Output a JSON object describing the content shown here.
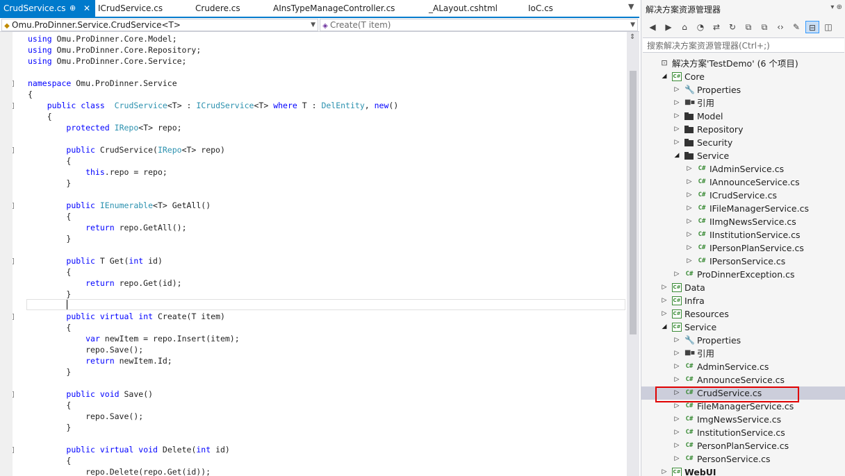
{
  "editor": {
    "tabs": [
      {
        "label": "CrudService.cs",
        "active": true
      },
      {
        "label": "ICrudService.cs"
      },
      {
        "label": "Crudere.cs"
      },
      {
        "label": "AInsTypeManageController.cs"
      },
      {
        "label": "_ALayout.cshtml"
      },
      {
        "label": "IoC.cs"
      }
    ],
    "tab_pin": "⊕",
    "tab_close": "✕",
    "overflow_glyph": "▼",
    "nav_left": "Omu.ProDinner.Service.CrudService<T>",
    "nav_right": "Create(T item)",
    "code_lines": [
      {
        "text": "using Omu.ProDinner.Core.Model;",
        "fold": ""
      },
      {
        "text": "using Omu.ProDinner.Core.Repository;",
        "fold": ""
      },
      {
        "text": "using Omu.ProDinner.Core.Service;",
        "fold": ""
      },
      {
        "text": "",
        "fold": ""
      },
      {
        "text": "namespace Omu.ProDinner.Service",
        "fold": "−"
      },
      {
        "text": "{",
        "fold": ""
      },
      {
        "text": "    public class  CrudService<T> : ICrudService<T> where T : DelEntity, new()",
        "fold": "−"
      },
      {
        "text": "    {",
        "fold": ""
      },
      {
        "text": "        protected IRepo<T> repo;",
        "fold": ""
      },
      {
        "text": "",
        "fold": ""
      },
      {
        "text": "        public CrudService(IRepo<T> repo)",
        "fold": "−"
      },
      {
        "text": "        {",
        "fold": ""
      },
      {
        "text": "            this.repo = repo;",
        "fold": ""
      },
      {
        "text": "        }",
        "fold": ""
      },
      {
        "text": "",
        "fold": ""
      },
      {
        "text": "        public IEnumerable<T> GetAll()",
        "fold": "−"
      },
      {
        "text": "        {",
        "fold": ""
      },
      {
        "text": "            return repo.GetAll();",
        "fold": ""
      },
      {
        "text": "        }",
        "fold": ""
      },
      {
        "text": "",
        "fold": ""
      },
      {
        "text": "        public T Get(int id)",
        "fold": "−"
      },
      {
        "text": "        {",
        "fold": ""
      },
      {
        "text": "            return repo.Get(id);",
        "fold": ""
      },
      {
        "text": "        }",
        "fold": ""
      },
      {
        "text": "",
        "fold": ""
      },
      {
        "text": "        public virtual int Create(T item)",
        "fold": "−"
      },
      {
        "text": "        {",
        "fold": ""
      },
      {
        "text": "            var newItem = repo.Insert(item);",
        "fold": ""
      },
      {
        "text": "            repo.Save();",
        "fold": ""
      },
      {
        "text": "            return newItem.Id;",
        "fold": ""
      },
      {
        "text": "        }",
        "fold": ""
      },
      {
        "text": "",
        "fold": ""
      },
      {
        "text": "        public void Save()",
        "fold": "−"
      },
      {
        "text": "        {",
        "fold": ""
      },
      {
        "text": "            repo.Save();",
        "fold": ""
      },
      {
        "text": "        }",
        "fold": ""
      },
      {
        "text": "",
        "fold": ""
      },
      {
        "text": "        public virtual void Delete(int id)",
        "fold": "−"
      },
      {
        "text": "        {",
        "fold": ""
      },
      {
        "text": "            repo.Delete(repo.Get(id));",
        "fold": ""
      }
    ]
  },
  "explorer": {
    "title": "解决方案资源管理器",
    "title_buttons": "▾ ⊕",
    "toolbar": [
      "◀",
      "▶",
      "⌂",
      "◔",
      "⇄",
      "↻",
      "⧉",
      "⧉",
      "‹›",
      "✎",
      "⊟",
      "◫"
    ],
    "search_placeholder": "搜索解决方案资源管理器(Ctrl+;)",
    "tree": [
      {
        "label": "解决方案'TestDemo' (6 个项目)",
        "depth": 0,
        "icon": "sln",
        "arrow": ""
      },
      {
        "label": "Core",
        "depth": 1,
        "icon": "proj",
        "arrow": "open"
      },
      {
        "label": "Properties",
        "depth": 2,
        "icon": "wrench",
        "arrow": "closed"
      },
      {
        "label": "引用",
        "depth": 2,
        "icon": "refs",
        "arrow": "closed"
      },
      {
        "label": "Model",
        "depth": 2,
        "icon": "folder",
        "arrow": "closed"
      },
      {
        "label": "Repository",
        "depth": 2,
        "icon": "folder",
        "arrow": "closed"
      },
      {
        "label": "Security",
        "depth": 2,
        "icon": "folder",
        "arrow": "closed"
      },
      {
        "label": "Service",
        "depth": 2,
        "icon": "folder",
        "arrow": "open"
      },
      {
        "label": "IAdminService.cs",
        "depth": 3,
        "icon": "cs",
        "arrow": "closed"
      },
      {
        "label": "IAnnounceService.cs",
        "depth": 3,
        "icon": "cs",
        "arrow": "closed"
      },
      {
        "label": "ICrudService.cs",
        "depth": 3,
        "icon": "cs",
        "arrow": "closed"
      },
      {
        "label": "IFileManagerService.cs",
        "depth": 3,
        "icon": "cs",
        "arrow": "closed"
      },
      {
        "label": "IImgNewsService.cs",
        "depth": 3,
        "icon": "cs",
        "arrow": "closed"
      },
      {
        "label": "IInstitutionService.cs",
        "depth": 3,
        "icon": "cs",
        "arrow": "closed"
      },
      {
        "label": "IPersonPlanService.cs",
        "depth": 3,
        "icon": "cs",
        "arrow": "closed"
      },
      {
        "label": "IPersonService.cs",
        "depth": 3,
        "icon": "cs",
        "arrow": "closed"
      },
      {
        "label": "ProDinnerException.cs",
        "depth": 2,
        "icon": "cs",
        "arrow": "closed"
      },
      {
        "label": "Data",
        "depth": 1,
        "icon": "proj",
        "arrow": "closed"
      },
      {
        "label": "Infra",
        "depth": 1,
        "icon": "proj",
        "arrow": "closed"
      },
      {
        "label": "Resources",
        "depth": 1,
        "icon": "proj",
        "arrow": "closed"
      },
      {
        "label": "Service",
        "depth": 1,
        "icon": "proj",
        "arrow": "open"
      },
      {
        "label": "Properties",
        "depth": 2,
        "icon": "wrench",
        "arrow": "closed"
      },
      {
        "label": "引用",
        "depth": 2,
        "icon": "refs",
        "arrow": "closed"
      },
      {
        "label": "AdminService.cs",
        "depth": 2,
        "icon": "cs",
        "arrow": "closed"
      },
      {
        "label": "AnnounceService.cs",
        "depth": 2,
        "icon": "cs",
        "arrow": "closed"
      },
      {
        "label": "CrudService.cs",
        "depth": 2,
        "icon": "cs",
        "arrow": "closed",
        "selected": true
      },
      {
        "label": "FileManagerService.cs",
        "depth": 2,
        "icon": "cs",
        "arrow": "closed"
      },
      {
        "label": "ImgNewsService.cs",
        "depth": 2,
        "icon": "cs",
        "arrow": "closed"
      },
      {
        "label": "InstitutionService.cs",
        "depth": 2,
        "icon": "cs",
        "arrow": "closed"
      },
      {
        "label": "PersonPlanService.cs",
        "depth": 2,
        "icon": "cs",
        "arrow": "closed"
      },
      {
        "label": "PersonService.cs",
        "depth": 2,
        "icon": "cs",
        "arrow": "closed"
      },
      {
        "label": "WebUI",
        "depth": 1,
        "icon": "proj",
        "arrow": "closed",
        "bold": true
      }
    ]
  },
  "colors": {
    "accent": "#007acc",
    "keyword": "#0000ff",
    "type": "#2b91af",
    "highlight": "#e00000"
  }
}
